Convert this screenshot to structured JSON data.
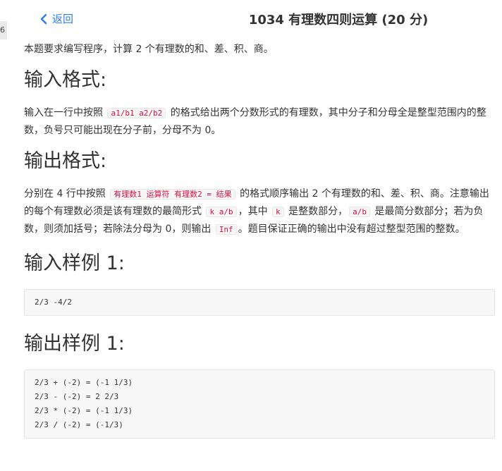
{
  "header": {
    "back_label": "返回",
    "title": "1034 有理数四则运算 (20 分)",
    "left_tab": "6"
  },
  "intro": "本题要求编写程序，计算 2 个有理数的和、差、积、商。",
  "sections": {
    "input_format": {
      "heading": "输入格式:",
      "t1": "输入在一行中按照 ",
      "c1": "a1/b1 a2/b2",
      "t2": " 的格式给出两个分数形式的有理数，其中分子和分母全是整型范围内的整数，负号只可能出现在分子前，分母不为 0。"
    },
    "output_format": {
      "heading": "输出格式:",
      "t1": "分别在 4 行中按照 ",
      "c1": "有理数1 运算符 有理数2 = 结果",
      "t2": " 的格式顺序输出 2 个有理数的和、差、积、商。注意输出的每个有理数必须是该有理数的最简形式 ",
      "c2": "k a/b",
      "t3": "，其中 ",
      "c3": "k",
      "t4": " 是整数部分，",
      "c4": "a/b",
      "t5": " 是最简分数部分；若为负数，则须加括号；若除法分母为 0，则输出 ",
      "c5": "Inf",
      "t6": "。题目保证正确的输出中没有超过整型范围的整数。"
    },
    "sample_input": {
      "heading": "输入样例 1:",
      "code": "2/3 -4/2"
    },
    "sample_output": {
      "heading": "输出样例 1:",
      "code": "2/3 + (-2) = (-1 1/3)\n2/3 - (-2) = 2 2/3\n2/3 * (-2) = (-1 1/3)\n2/3 / (-2) = (-1/3)"
    }
  },
  "colors": {
    "link": "#2f80ed",
    "inline_code": "#dd1144",
    "code_bg": "#f7f7f7"
  }
}
